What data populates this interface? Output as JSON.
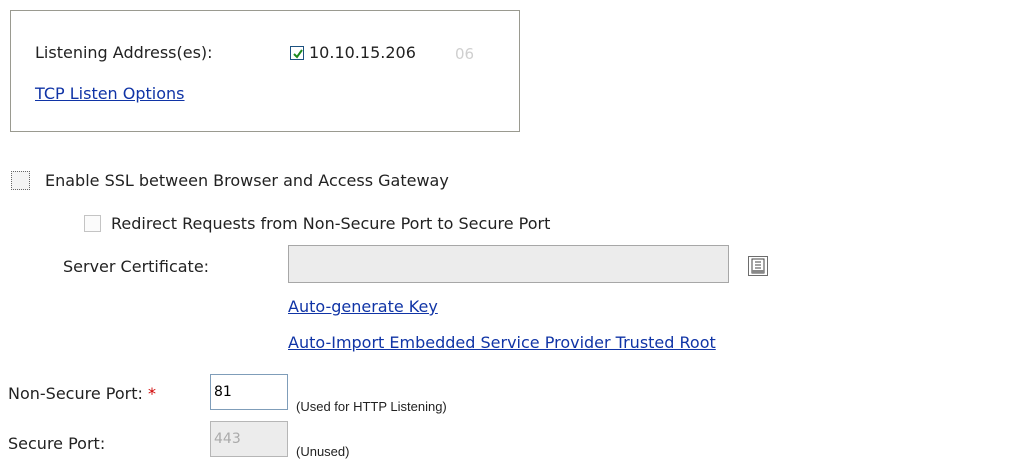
{
  "listening": {
    "label": "Listening Address(es):",
    "address_checked": true,
    "address": "10.10.15.206",
    "address_ghost": "06",
    "tcp_options_link": "TCP Listen Options"
  },
  "ssl": {
    "enable_label": "Enable SSL between Browser and Access Gateway",
    "enable_checked": false,
    "redirect_label": "Redirect Requests from Non-Secure Port to Secure Port",
    "redirect_checked": false,
    "server_cert_label": "Server Certificate:",
    "server_cert_value": "",
    "auto_generate_link": "Auto-generate Key",
    "auto_import_link": "Auto-Import Embedded Service Provider Trusted Root"
  },
  "ports": {
    "non_secure_label": "Non-Secure Port:",
    "required_marker": "*",
    "non_secure_value": "81",
    "non_secure_note": "(Used for HTTP Listening)",
    "secure_label": "Secure Port:",
    "secure_value": "443",
    "secure_note": "(Unused)"
  },
  "icons": {
    "checkmark": "checkmark-icon",
    "browse": "certificate-browse-icon"
  },
  "colors": {
    "link": "#1034a6",
    "required": "#d00000",
    "check_green": "#1e8a1e"
  }
}
